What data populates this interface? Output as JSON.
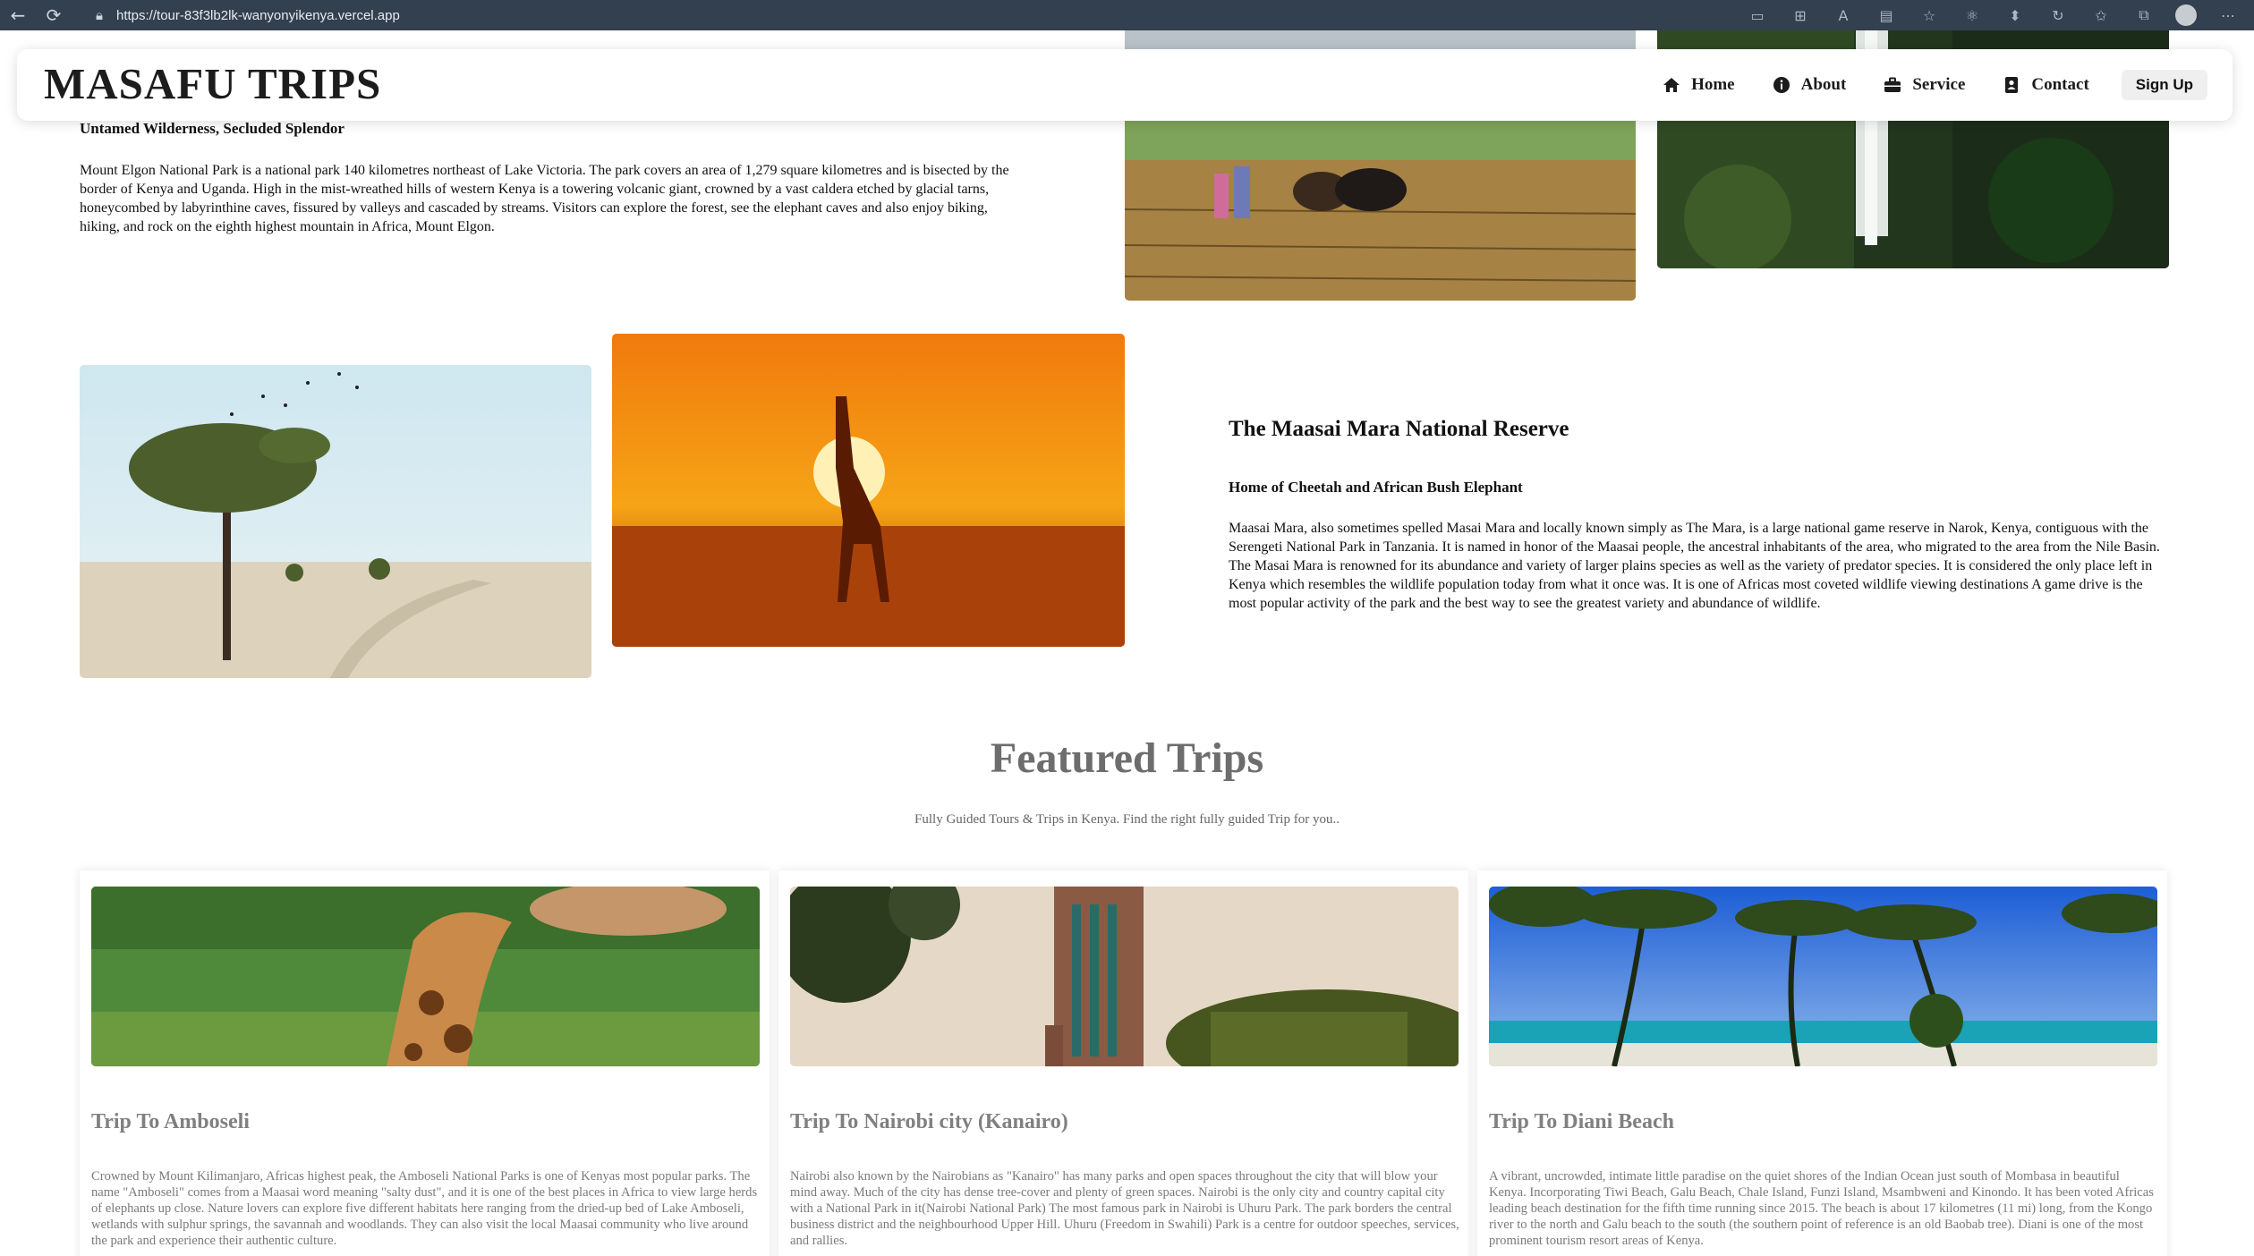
{
  "browser": {
    "url": "https://tour-83f3lb2lk-wanyonyikenya.vercel.app"
  },
  "header": {
    "brand": "MASAFU TRIPS",
    "nav": [
      {
        "label": "Home",
        "icon": "home-icon"
      },
      {
        "label": "About",
        "icon": "info-icon"
      },
      {
        "label": "Service",
        "icon": "briefcase-icon"
      },
      {
        "label": "Contact",
        "icon": "contact-card-icon"
      }
    ],
    "signup_label": "Sign Up"
  },
  "elgon": {
    "tagline": "Untamed Wilderness, Secluded Splendor",
    "body": "Mount Elgon National Park is a national park 140 kilometres northeast of Lake Victoria. The park covers an area of 1,279 square kilometres and is bisected by the border of Kenya and Uganda. High in the mist-wreathed hills of western Kenya is a towering volcanic giant, crowned by a vast caldera etched by glacial tarns, honeycombed by labyrinthine caves, fissured by valleys and cascaded by streams. Visitors can explore the forest, see the elephant caves and also enjoy biking, hiking, and rock on the eighth highest mountain in Africa, Mount Elgon."
  },
  "mara": {
    "title": "The Maasai Mara National Reserve",
    "tagline": "Home of Cheetah and African Bush Elephant",
    "body": "Maasai Mara, also sometimes spelled Masai Mara and locally known simply as The Mara, is a large national game reserve in Narok, Kenya, contiguous with the Serengeti National Park in Tanzania. It is named in honor of the Maasai people, the ancestral inhabitants of the area, who migrated to the area from the Nile Basin. The Masai Mara is renowned for its abundance and variety of larger plains species as well as the variety of predator species. It is considered the only place left in Kenya which resembles the wildlife population today from what it once was. It is one of Africas most coveted wildlife viewing destinations A game drive is the most popular activity of the park and the best way to see the greatest variety and abundance of wildlife."
  },
  "featured": {
    "title": "Featured Trips",
    "subtitle": "Fully Guided Tours & Trips in Kenya. Find the right fully guided Trip for you..",
    "cards": [
      {
        "title": "Trip To Amboseli",
        "description": "Crowned by Mount Kilimanjaro, Africas highest peak, the Amboseli National Parks is one of Kenyas most popular parks. The name \"Amboseli\" comes from a Maasai word meaning \"salty dust\", and it is one of the best places in Africa to view large herds of elephants up close. Nature lovers can explore five different habitats here ranging from the dried-up bed of Lake Amboseli, wetlands with sulphur springs, the savannah and woodlands. They can also visit the local Maasai community who live around the park and experience their authentic culture."
      },
      {
        "title": "Trip To Nairobi city (Kanairo)",
        "description": "Nairobi also known by the Nairobians as \"Kanairo\" has many parks and open spaces throughout the city that will blow your mind away. Much of the city has dense tree-cover and plenty of green spaces. Nairobi is the only city and country capital city with a National Park in it(Nairobi National Park) The most famous park in Nairobi is Uhuru Park. The park borders the central business district and the neighbourhood Upper Hill. Uhuru (Freedom in Swahili) Park is a centre for outdoor speeches, services, and rallies."
      },
      {
        "title": "Trip To Diani Beach",
        "description": "A vibrant, uncrowded, intimate little paradise on the quiet shores of the Indian Ocean just south of Mombasa in beautiful Kenya. Incorporating Tiwi Beach, Galu Beach, Chale Island, Funzi Island, Msambweni and Kinondo. It has been voted Africas leading beach destination for the fifth time running since 2015. The beach is about 17 kilometres (11 mi) long, from the Kongo river to the north and Galu beach to the south (the southern point of reference is an old Baobab tree). Diani is one of the most prominent tourism resort areas of Kenya."
      }
    ]
  }
}
